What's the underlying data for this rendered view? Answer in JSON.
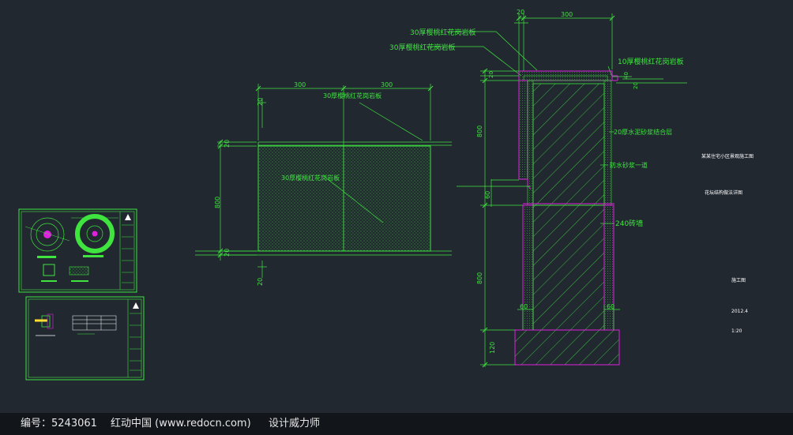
{
  "colors": {
    "background": "#212830",
    "line": "#3fe43f",
    "accent": "#e020e0",
    "text": "#3fe43f",
    "white": "#ffffff",
    "footer_bg": "#12151a"
  },
  "elevation": {
    "dim_300_left": "300",
    "dim_300_right": "300",
    "dim_20_top": "20",
    "dim_20_left": "20",
    "dim_800": "800",
    "dim_20_bottom": "20",
    "dim_20_below": "20",
    "label_top": "30厚樱桃红花岗岩板",
    "label_center": "30厚樱桃红花岗岩板"
  },
  "section": {
    "dim_20_top": "20",
    "dim_300_top": "300",
    "label_1": "30厚樱桃红花岗岩板",
    "label_2": "30厚樱桃红花岗岩板",
    "label_3": "10厚樱桃红花岗岩板",
    "dim_40": "40",
    "dim_20_side": "20",
    "dim_20_left": "20",
    "label_mortar": "20厚水泥砂浆结合层",
    "label_waterproof": "防水砂浆一道",
    "dim_800_upper": "800",
    "dim_60_mid": "60",
    "label_wall": "240砖墙",
    "dim_800_lower": "800",
    "dim_60_left": "60",
    "dim_60_right": "60",
    "dim_120": "120"
  },
  "titleblock": {
    "project": "某某住宅小区景观施工图",
    "drawing": "花坛结构做法详图",
    "stage": "施工图",
    "date": "2012.4",
    "scale": "1:20"
  },
  "footer": {
    "id_text": "编号：5243061",
    "site_text": "红动中国 (www.redocn.com)",
    "designer_text": "设计威力师"
  }
}
